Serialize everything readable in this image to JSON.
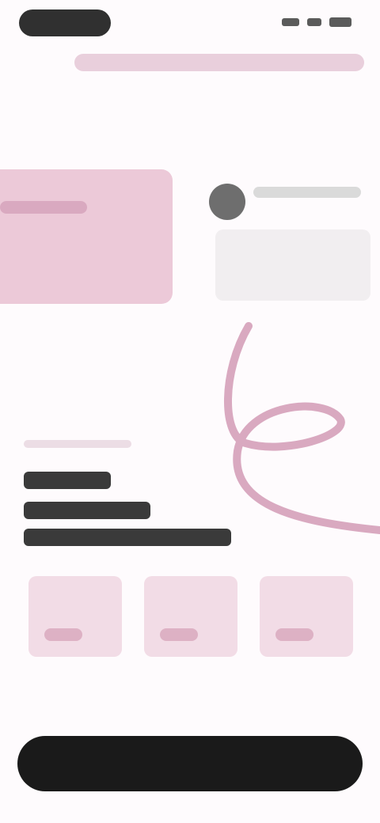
{
  "colors": {
    "background": "#fefbfd",
    "accent_pink": "#ecc9d8",
    "squiggle_pink": "#d9a9c0",
    "dark_button": "#1a1a1a"
  },
  "icons": {
    "signal": "signal-icon",
    "wifi": "wifi-icon",
    "battery": "battery-icon"
  }
}
